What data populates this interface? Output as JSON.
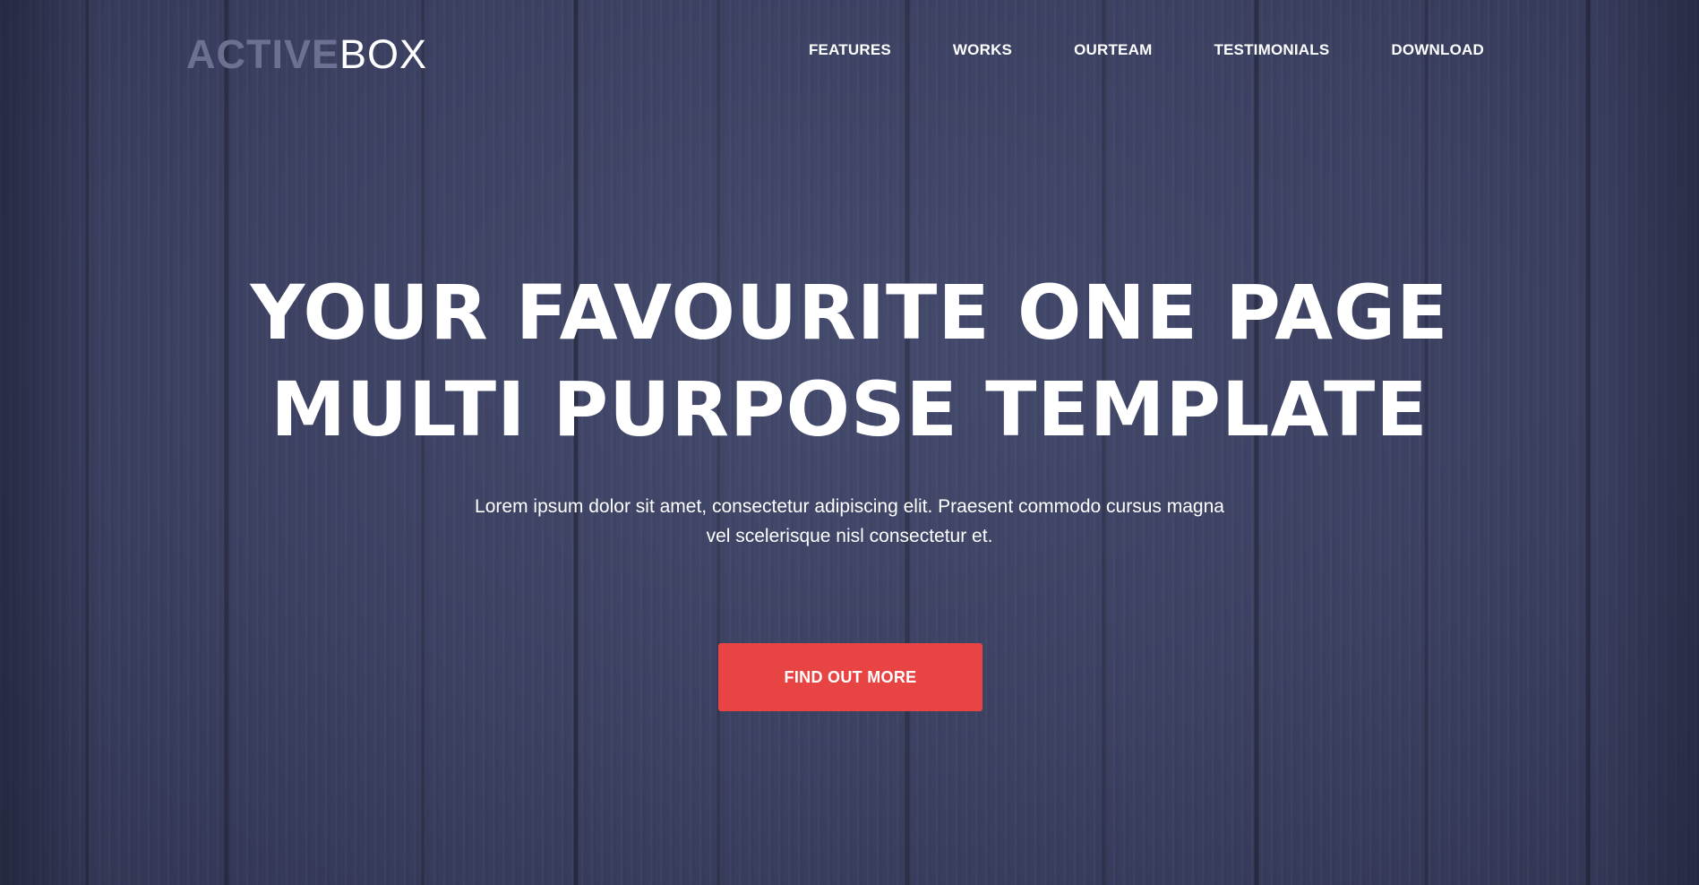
{
  "brand": {
    "logo_part1": "ACTIVE",
    "logo_part2": "BOX"
  },
  "nav": {
    "items": [
      {
        "label": "FEATURES"
      },
      {
        "label": "WORKS"
      },
      {
        "label": "OURTEAM"
      },
      {
        "label": "TESTIMONIALS"
      },
      {
        "label": "DOWNLOAD"
      }
    ]
  },
  "hero": {
    "headline_line1": "YOUR FAVOURITE ONE PAGE",
    "headline_line2": "MULTI PURPOSE TEMPLATE",
    "subtext_line1": "Lorem ipsum dolor sit amet, consectetur adipiscing elit. Praesent commodo cursus magna",
    "subtext_line2": "vel scelerisque nisl consectetur et.",
    "cta_label": "FIND OUT MORE"
  },
  "colors": {
    "background": "#3d4263",
    "accent": "#e84444",
    "logo_muted": "#6c7091",
    "text": "#ffffff"
  }
}
